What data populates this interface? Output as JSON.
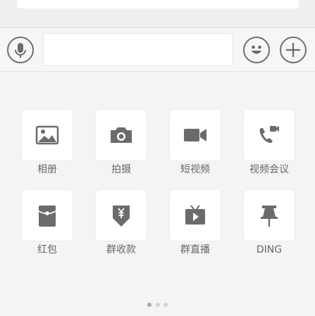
{
  "input": {
    "value": "",
    "placeholder": ""
  },
  "icons": {
    "voice": "microphone-icon",
    "emoji": "emoji-icon",
    "more": "plus-icon"
  },
  "actions": [
    {
      "label": "相册",
      "icon": "photo-album-icon"
    },
    {
      "label": "拍摄",
      "icon": "camera-icon"
    },
    {
      "label": "短视频",
      "icon": "video-camera-icon"
    },
    {
      "label": "视频会议",
      "icon": "video-call-icon"
    },
    {
      "label": "红包",
      "icon": "red-packet-icon"
    },
    {
      "label": "群收款",
      "icon": "group-collection-icon"
    },
    {
      "label": "群直播",
      "icon": "group-live-icon"
    },
    {
      "label": "DING",
      "icon": "ding-pin-icon"
    }
  ],
  "pager": {
    "pages": 3,
    "current": 1
  },
  "colors": {
    "icon": "#6b6b6b",
    "background": "#f4f4f4",
    "tile": "#ffffff"
  }
}
